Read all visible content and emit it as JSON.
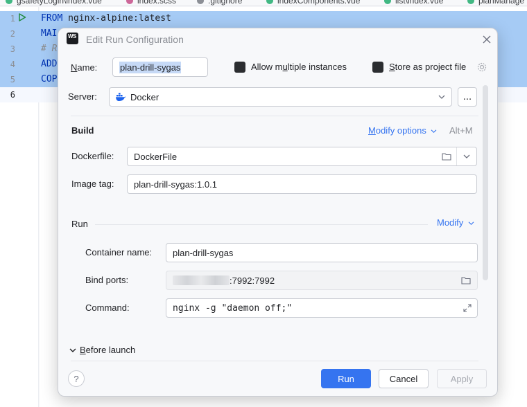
{
  "editor": {
    "tabs": [
      {
        "label": "gsafetyLogin\\index.vue",
        "color": "#41b883"
      },
      {
        "label": "index.scss",
        "color": "#cd6799"
      },
      {
        "label": ".gitignore",
        "color": "#8c8f96"
      },
      {
        "label": "indexComponents.vue",
        "color": "#41b883"
      },
      {
        "label": "list\\index.vue",
        "color": "#41b883"
      },
      {
        "label": "planManage",
        "color": "#41b883"
      }
    ],
    "lines": [
      {
        "num": "1",
        "kw": "FROM",
        "rest": " nginx-alpine:latest"
      },
      {
        "num": "2",
        "kw": "MAI",
        "rest": ""
      },
      {
        "num": "3",
        "kw": "",
        "rest": "# R"
      },
      {
        "num": "4",
        "kw": "ADD",
        "rest": ""
      },
      {
        "num": "5",
        "kw": "COP",
        "rest": ""
      },
      {
        "num": "6",
        "kw": "",
        "rest": ""
      }
    ]
  },
  "dialog": {
    "title": "Edit Run Configuration",
    "logo": "WS",
    "name_label": "Name:",
    "name_value": "plan-drill-sygas",
    "allow_multiple": {
      "prefix": "Allow m",
      "underlined": "u",
      "suffix": "ltiple instances"
    },
    "store_project": {
      "prefix": "",
      "underlined": "S",
      "suffix": "tore as project file"
    },
    "server_label": "Server:",
    "server_value": "Docker",
    "server_more": "...",
    "build": {
      "heading": "Build",
      "modify_options": {
        "underlined": "M",
        "suffix": "odify options"
      },
      "shortcut": "Alt+M",
      "dockerfile_label": "Dockerfile:",
      "dockerfile_value": "DockerFile",
      "image_tag_label": "Image tag:",
      "image_tag_value": "plan-drill-sygas:1.0.1"
    },
    "run": {
      "heading": "Run",
      "modify": "Modify",
      "container_label": "Container name:",
      "container_value": "plan-drill-sygas",
      "bind_label": "Bind ports:",
      "bind_value": ":7992:7992",
      "command_label": "Command:",
      "command_value": "nginx -g \"daemon off;\""
    },
    "before_launch": {
      "underlined": "B",
      "suffix": "efore launch"
    },
    "help": "?",
    "buttons": {
      "run": "Run",
      "cancel": "Cancel",
      "apply": "Apply"
    }
  },
  "colors": {
    "accent": "#3574f0",
    "selection": "#a6cbf5",
    "docker": "#1d63ed"
  }
}
